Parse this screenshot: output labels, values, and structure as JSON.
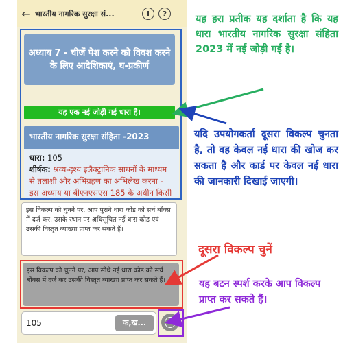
{
  "app": {
    "back_icon": "arrow-left-icon",
    "title": "भारतीय नागरिक सुरक्षा सं...",
    "info_label": "i",
    "help_label": "?"
  },
  "chapter": {
    "label": "अध्याय 7 - चीजें पेश करने को विवश करने के लिए आदेशिकाएं, घ-प्रकीर्ण"
  },
  "new_section_banner": "यह एक नई जोड़ी गई धारा है।",
  "section_card": {
    "heading": "भारतीय नागरिक सुरक्षा संहिता -2023",
    "section_label": "धारा:",
    "section_value": "105",
    "title_label": "शीर्षक:",
    "title_text": "श्रव्य-दृश्य इलैक्ट्रानिक साधनों के माध्यम से तलाशी और अभिग्रहण का अभिलेख करना - इस अध्याय या बीएनएसएस 185 के अधीन किसी संपत्ति, वस्तु या"
  },
  "options": [
    {
      "text": "इस विकल्प को चुनने पर, आप पुराने धारा कोड को सर्च बॉक्स में दर्ज कर, उसके स्थान पर अधिसूचित नई धारा कोड एवं उसकी विस्तृत व्याख्या प्राप्त कर सकते हैं।"
    },
    {
      "text": "इस विकल्प को चुनने पर, आप सीधे नई धारा कोड को सर्च बॉक्स में दर्ज कर उसकी विस्तृत व्याख्या प्राप्त कर सकते हैं।"
    }
  ],
  "search": {
    "value": "105",
    "chip_label": "क,ख...",
    "toggle_icon": "chevron-down-circle-icon"
  },
  "annotations": {
    "green": "यह हरा प्रतीक यह दर्शाता है कि यह धारा भारतीय नागरिक सुरक्षा संहिता 2023 में नई जोड़ी गई है।",
    "blue": "यदि उपयोगकर्ता दूसरा विकल्प चुनता है, तो वह केवल नई धारा की खोज कर सकता है और कार्ड पर केवल नई धारा की जानकारी दिखाई जाएगी।",
    "red": "दूसरा विकल्प चुनें",
    "purple": "यह बटन स्पर्श करके आप विकल्प प्राप्त कर सकते हैं।"
  },
  "colors": {
    "green": "#27ae60",
    "blue": "#1e44b8",
    "red": "#e53935",
    "purple": "#8e2ad8"
  }
}
